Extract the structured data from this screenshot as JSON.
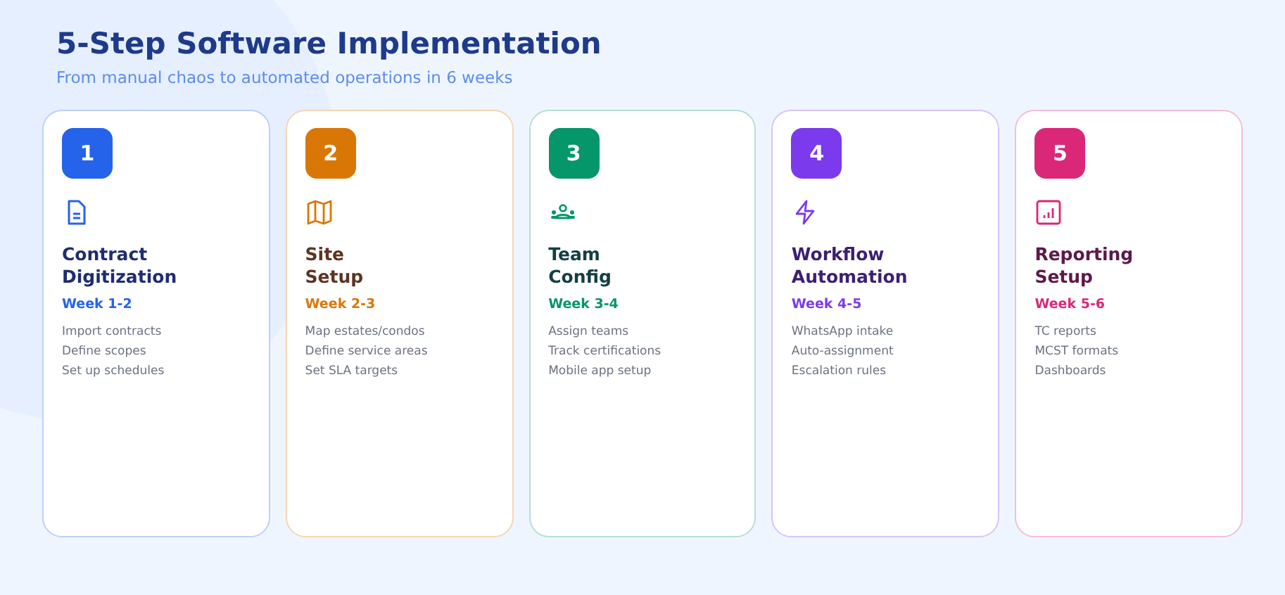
{
  "title": "5-Step Software Implementation",
  "subtitle": "From manual chaos to automated operations in 6 weeks",
  "steps": [
    {
      "number": "1",
      "kind": "document",
      "color": "#2563eb",
      "title": [
        "Contract",
        "Digitization"
      ],
      "weeks": "Week 1-2",
      "tasks": [
        "Import contracts",
        "Define scopes",
        "Set up schedules"
      ]
    },
    {
      "number": "2",
      "kind": "map",
      "color": "#d97706",
      "title": [
        "Site",
        "Setup"
      ],
      "weeks": "Week 2-3",
      "tasks": [
        "Map estates/condos",
        "Define service areas",
        "Set SLA targets"
      ]
    },
    {
      "number": "3",
      "kind": "team",
      "color": "#059669",
      "title": [
        "Team",
        "Config"
      ],
      "weeks": "Week 3-4",
      "tasks": [
        "Assign teams",
        "Track certifications",
        "Mobile app setup"
      ]
    },
    {
      "number": "4",
      "kind": "bolt",
      "color": "#7c3aed",
      "title": [
        "Workflow",
        "Automation"
      ],
      "weeks": "Week 4-5",
      "tasks": [
        "WhatsApp intake",
        "Auto-assignment",
        "Escalation rules"
      ]
    },
    {
      "number": "5",
      "kind": "chart",
      "color": "#db2777",
      "title": [
        "Reporting",
        "Setup"
      ],
      "weeks": "Week 5-6",
      "tasks": [
        "TC reports",
        "MCST formats",
        "Dashboards"
      ]
    }
  ]
}
